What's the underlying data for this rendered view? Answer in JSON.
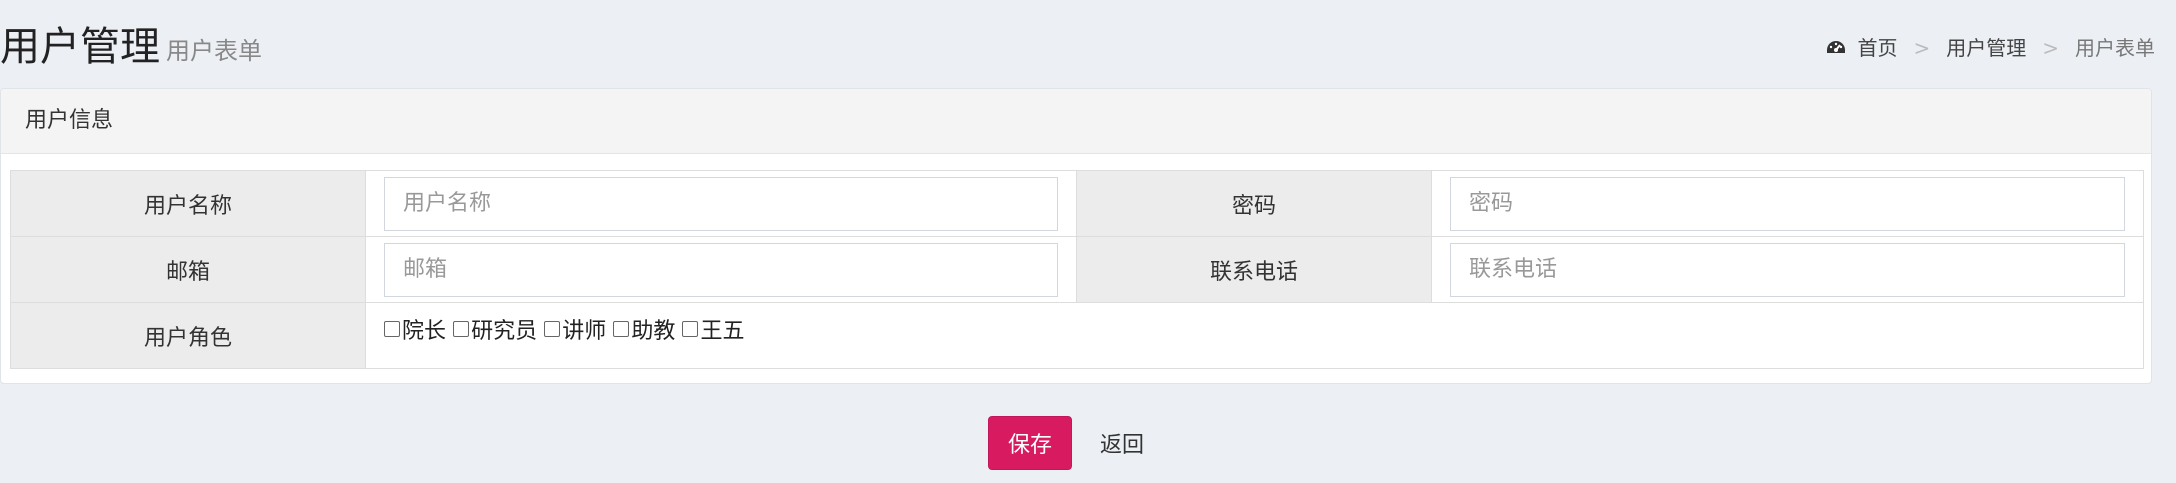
{
  "header": {
    "title": "用户管理",
    "subtitle": "用户表单"
  },
  "breadcrumb": {
    "home": "首页",
    "section": "用户管理",
    "current": "用户表单",
    "separator": ">"
  },
  "panel": {
    "title": "用户信息"
  },
  "form": {
    "username_label": "用户名称",
    "username_placeholder": "用户名称",
    "password_label": "密码",
    "password_placeholder": "密码",
    "email_label": "邮箱",
    "email_placeholder": "邮箱",
    "phone_label": "联系电话",
    "phone_placeholder": "联系电话",
    "roles_label": "用户角色",
    "roles": [
      {
        "label": "院长",
        "checked": false
      },
      {
        "label": "研究员",
        "checked": false
      },
      {
        "label": "讲师",
        "checked": false
      },
      {
        "label": "助教",
        "checked": false
      },
      {
        "label": "王五",
        "checked": false
      }
    ]
  },
  "actions": {
    "save_label": "保存",
    "back_label": "返回"
  },
  "colors": {
    "background": "#ecf0f5",
    "save_button": "#d81b60",
    "label_cell": "#ececec"
  },
  "icons": {
    "breadcrumb_home": "dashboard-icon"
  }
}
